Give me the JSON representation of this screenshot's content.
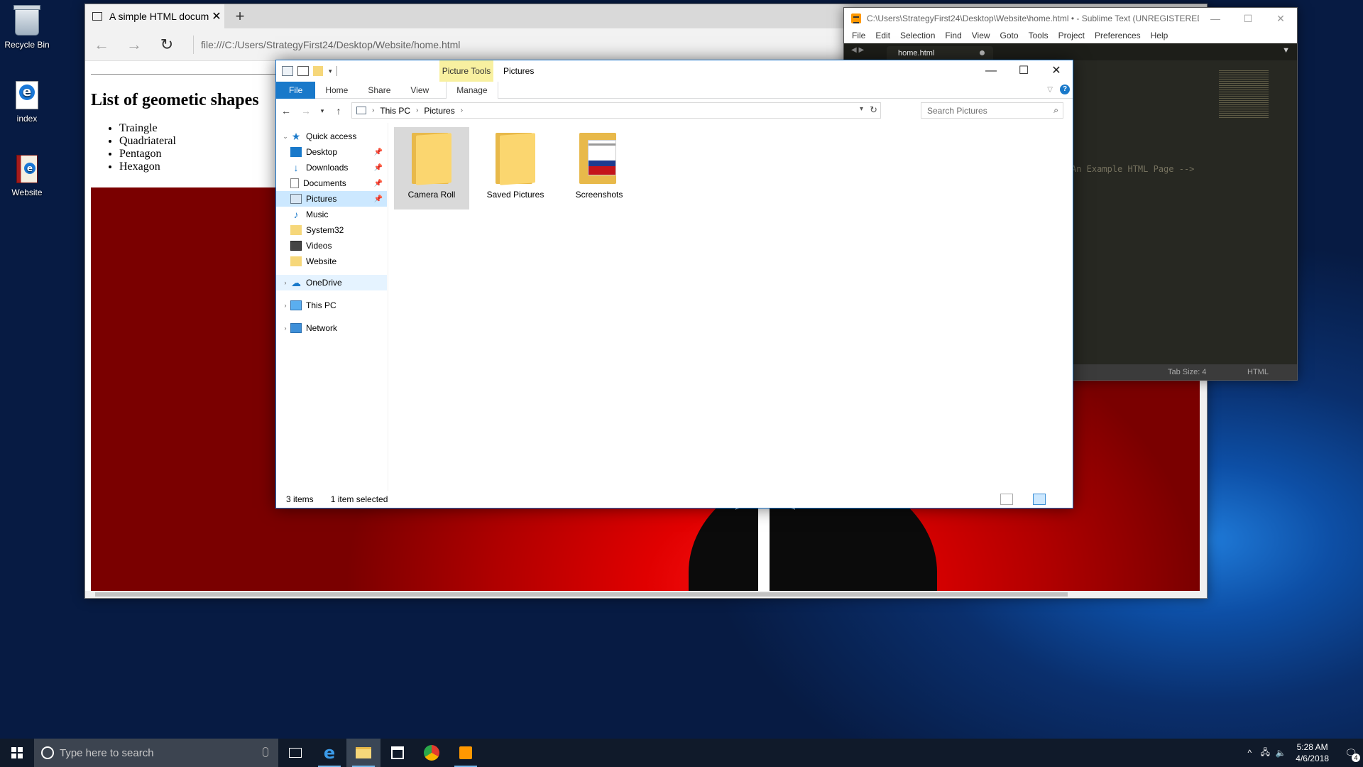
{
  "desktop": {
    "icons": [
      {
        "label": "Recycle Bin",
        "icon": "recycle-bin-icon"
      },
      {
        "label": "index",
        "icon": "edge-html-file-icon"
      },
      {
        "label": "Website",
        "icon": "winrar-archive-icon"
      }
    ]
  },
  "browser": {
    "tab_title": "A simple HTML docume",
    "new_tab": "+",
    "url": "file:///C:/Users/StrategyFirst24/Desktop/Website/home.html",
    "page": {
      "heading": "List of geometic shapes",
      "items": [
        "Traingle",
        "Quadriateral",
        "Pentagon",
        "Hexagon"
      ]
    }
  },
  "sublime": {
    "title": "C:\\Users\\StrategyFirst24\\Desktop\\Website\\home.html • - Sublime Text (UNREGISTERED)",
    "menu": [
      "File",
      "Edit",
      "Selection",
      "Find",
      "View",
      "Goto",
      "Tools",
      "Project",
      "Preferences",
      "Help"
    ],
    "tab": "home.html",
    "code_line": "An Example HTML Page -->",
    "status_tab_size": "Tab Size: 4",
    "status_syntax": "HTML"
  },
  "explorer": {
    "context_tab": "Picture Tools",
    "title": "Pictures",
    "ribbon_tabs": {
      "file": "File",
      "home": "Home",
      "share": "Share",
      "view": "View",
      "manage": "Manage"
    },
    "breadcrumb": [
      "This PC",
      "Pictures"
    ],
    "search_placeholder": "Search Pictures",
    "nav": {
      "quick_access": "Quick access",
      "desktop": "Desktop",
      "downloads": "Downloads",
      "documents": "Documents",
      "pictures": "Pictures",
      "music": "Music",
      "system32": "System32",
      "videos": "Videos",
      "website": "Website",
      "onedrive": "OneDrive",
      "this_pc": "This PC",
      "network": "Network"
    },
    "files": [
      {
        "name": "Camera Roll",
        "selected": true
      },
      {
        "name": "Saved Pictures",
        "selected": false
      },
      {
        "name": "Screenshots",
        "selected": false
      }
    ],
    "status": {
      "count": "3 items",
      "selected": "1 item selected"
    }
  },
  "taskbar": {
    "search_placeholder": "Type here to search",
    "pinned": [
      "task-view-icon",
      "edge-icon",
      "file-explorer-icon",
      "store-icon",
      "ccleaner-icon",
      "sublime-text-icon"
    ],
    "time": "5:28 AM",
    "date": "4/6/2018",
    "notification_count": "4"
  },
  "colors": {
    "accent": "#1979ca",
    "selection": "#cce8ff",
    "picture_tools": "#f8f0a0",
    "editor_bg": "#272822"
  }
}
